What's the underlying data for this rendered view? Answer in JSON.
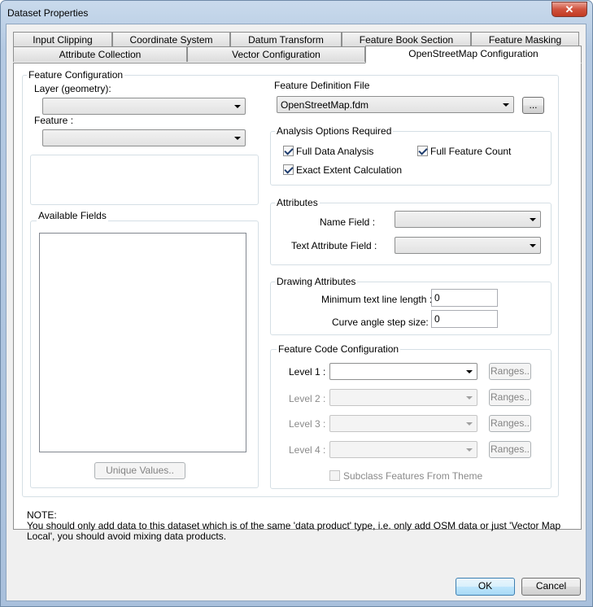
{
  "window": {
    "title": "Dataset Properties",
    "close_label": "✕"
  },
  "tabs_row1": [
    "Input Clipping",
    "Coordinate System",
    "Datum Transform",
    "Feature Book Section",
    "Feature Masking"
  ],
  "tabs_row2": [
    "Attribute Collection",
    "Vector Configuration",
    "OpenStreetMap Configuration"
  ],
  "feature_config": {
    "title": "Feature Configuration",
    "layer_label": "Layer (geometry):",
    "layer_value": "",
    "feature_label": "Feature :",
    "feature_value": ""
  },
  "available_fields": {
    "title": "Available Fields",
    "unique_values_button": "Unique Values.."
  },
  "feature_definition": {
    "label": "Feature Definition File",
    "value": "OpenStreetMap.fdm",
    "browse_label": "..."
  },
  "analysis_options": {
    "title": "Analysis Options Required",
    "full_data_analysis": "Full Data Analysis",
    "full_feature_count": "Full Feature Count",
    "exact_extent": "Exact Extent Calculation"
  },
  "attributes": {
    "title": "Attributes",
    "name_field_label": "Name Field :",
    "text_attribute_label": "Text Attribute Field :"
  },
  "drawing_attributes": {
    "title": "Drawing Attributes",
    "min_text_label": "Minimum text line length :",
    "min_text_value": "0",
    "curve_angle_label": "Curve angle step size:",
    "curve_angle_value": "0"
  },
  "feature_code": {
    "title": "Feature Code Configuration",
    "level1": "Level 1 :",
    "level2": "Level 2 :",
    "level3": "Level 3 :",
    "level4": "Level 4 :",
    "ranges_label": "Ranges..",
    "subclass_label": "Subclass Features From Theme"
  },
  "note": {
    "heading": "NOTE:",
    "text": "You should only add data to this dataset which is of the same 'data product' type, i.e. only add OSM data or just 'Vector Map Local', you should avoid mixing data products."
  },
  "buttons": {
    "ok": "OK",
    "cancel": "Cancel"
  }
}
